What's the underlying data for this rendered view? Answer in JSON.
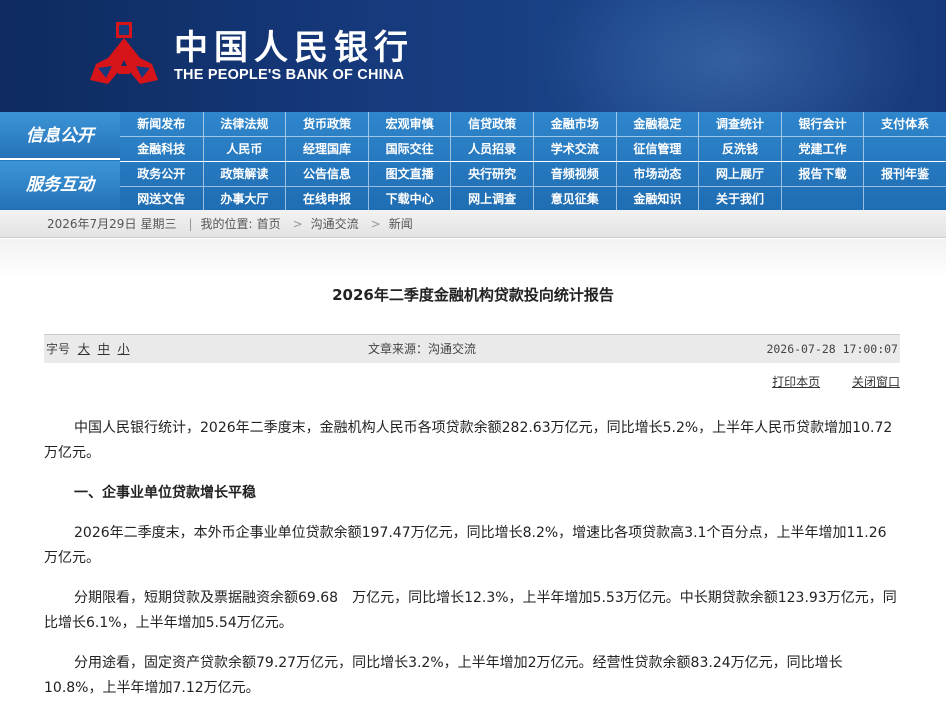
{
  "header": {
    "logo_cn": "中国人民银行",
    "logo_en": "THE PEOPLE'S BANK OF CHINA",
    "emblem_icon": "pboc-emblem-icon",
    "emblem_color": "#d7141a"
  },
  "nav": {
    "label_info": "信息公开",
    "label_service": "服务互动",
    "row1": [
      "新闻发布",
      "法律法规",
      "货币政策",
      "宏观审慎",
      "信贷政策",
      "金融市场",
      "金融稳定",
      "调查统计",
      "银行会计",
      "支付体系"
    ],
    "row2": [
      "金融科技",
      "人民币",
      "经理国库",
      "国际交往",
      "人员招录",
      "学术交流",
      "征信管理",
      "反洗钱",
      "党建工作",
      ""
    ],
    "row3": [
      "政务公开",
      "政策解读",
      "公告信息",
      "图文直播",
      "央行研究",
      "音频视频",
      "市场动态",
      "网上展厅",
      "报告下载",
      "报刊年鉴"
    ],
    "row4": [
      "网送文告",
      "办事大厅",
      "在线申报",
      "下载中心",
      "网上调查",
      "意见征集",
      "金融知识",
      "关于我们",
      "",
      ""
    ]
  },
  "breadcrumb": {
    "date": "2026年7月29日",
    "weekday": "星期三",
    "location_label": "我的位置:",
    "home": "首页",
    "level1": "沟通交流",
    "level2": "新闻"
  },
  "article": {
    "title": "2026年二季度金融机构贷款投向统计报告",
    "font_label": "字号",
    "font_large": "大",
    "font_medium": "中",
    "font_small": "小",
    "source": "文章来源：沟通交流",
    "datetime": "2026-07-28 17:00:07",
    "print": "打印本页",
    "close": "关闭窗口",
    "p1": "中国人民银行统计，2026年二季度末，金融机构人民币各项贷款余额282.63万亿元，同比增长5.2%，上半年人民币贷款增加10.72万亿元。",
    "h1": "一、企事业单位贷款增长平稳",
    "p2": "2026年二季度末，本外币企事业单位贷款余额197.47万亿元，同比增长8.2%，增速比各项贷款高3.1个百分点，上半年增加11.26万亿元。",
    "p3": "分期限看，短期贷款及票据融资余额69.68　万亿元，同比增长12.3%，上半年增加5.53万亿元。中长期贷款余额123.93万亿元，同比增长6.1%，上半年增加5.54万亿元。",
    "p4": "分用途看，固定资产贷款余额79.27万亿元，同比增长3.2%，上半年增加2万亿元。经营性贷款余额83.24万亿元，同比增长10.8%，上半年增加7.12万亿元。"
  }
}
